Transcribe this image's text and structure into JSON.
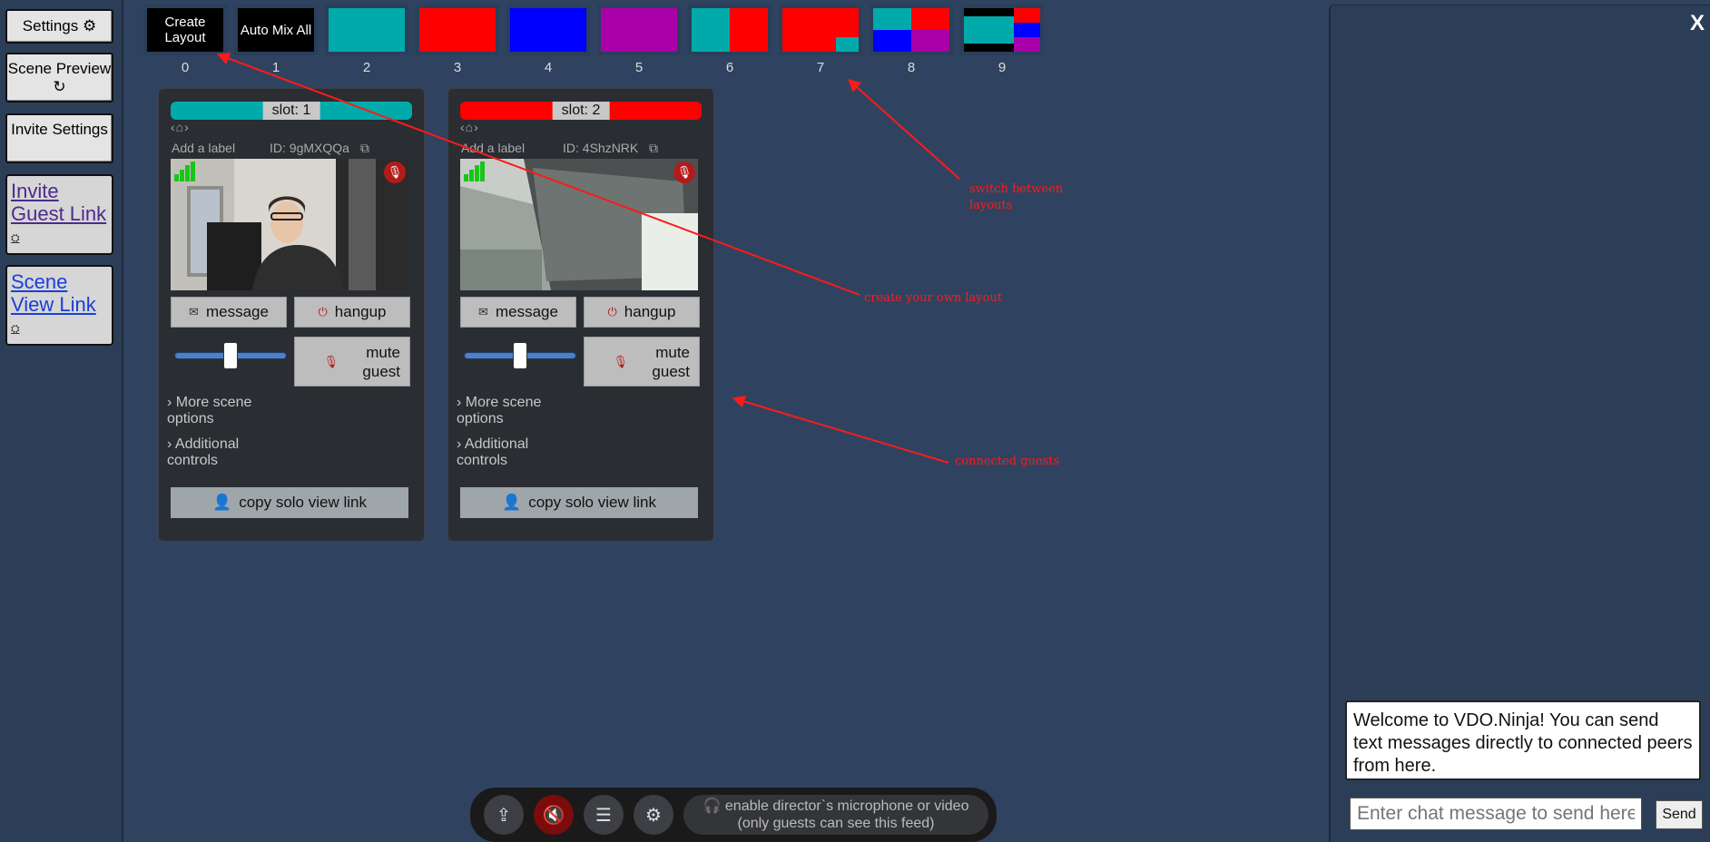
{
  "sidebar": {
    "settings_label": "Settings ⚙",
    "scene_preview_label": "Scene Preview ↻",
    "invite_settings_label": "Invite Settings",
    "invite_guest_link": "Invite Guest Link",
    "scene_view_link": "Scene View Link"
  },
  "layouts": [
    {
      "label": "0",
      "text": "Create Layout"
    },
    {
      "label": "1",
      "text": "Auto Mix All"
    },
    {
      "label": "2"
    },
    {
      "label": "3"
    },
    {
      "label": "4"
    },
    {
      "label": "5"
    },
    {
      "label": "6"
    },
    {
      "label": "7"
    },
    {
      "label": "8"
    },
    {
      "label": "9"
    }
  ],
  "guests": [
    {
      "slot": "slot: 1",
      "slot_color": "#00aaaa",
      "add_label": "Add a label",
      "id": "ID: 9gMXQQa",
      "message": "message",
      "hangup": "hangup",
      "mute": "mute guest",
      "more_scene": "More scene options",
      "additional": "Additional controls",
      "solo": "copy solo view link",
      "volume_fraction": 0.5
    },
    {
      "slot": "slot: 2",
      "slot_color": "#ff0000",
      "add_label": "Add a label",
      "id": "ID: 4ShzNRK",
      "message": "message",
      "hangup": "hangup",
      "mute": "mute guest",
      "more_scene": "More scene options",
      "additional": "Additional controls",
      "solo": "copy solo view link",
      "volume_fraction": 0.5
    }
  ],
  "annotations": {
    "switch": "switch between layouts",
    "create": "create your own layout",
    "connected": "connected guests"
  },
  "chat": {
    "close": "X",
    "welcome": "Welcome to VDO.Ninja! You can send text messages directly to connected peers from here.",
    "placeholder": "Enter chat message to send here",
    "send": "Send"
  },
  "toolbar": {
    "mic_text_1": "enable director`s microphone or video",
    "mic_text_2": "(only guests can see this feed)"
  },
  "colors": {
    "teal": "#00aaaa",
    "red": "#ff0000",
    "blue": "#0000ff",
    "purple": "#aa00aa",
    "annotation": "#ff1a1a"
  }
}
